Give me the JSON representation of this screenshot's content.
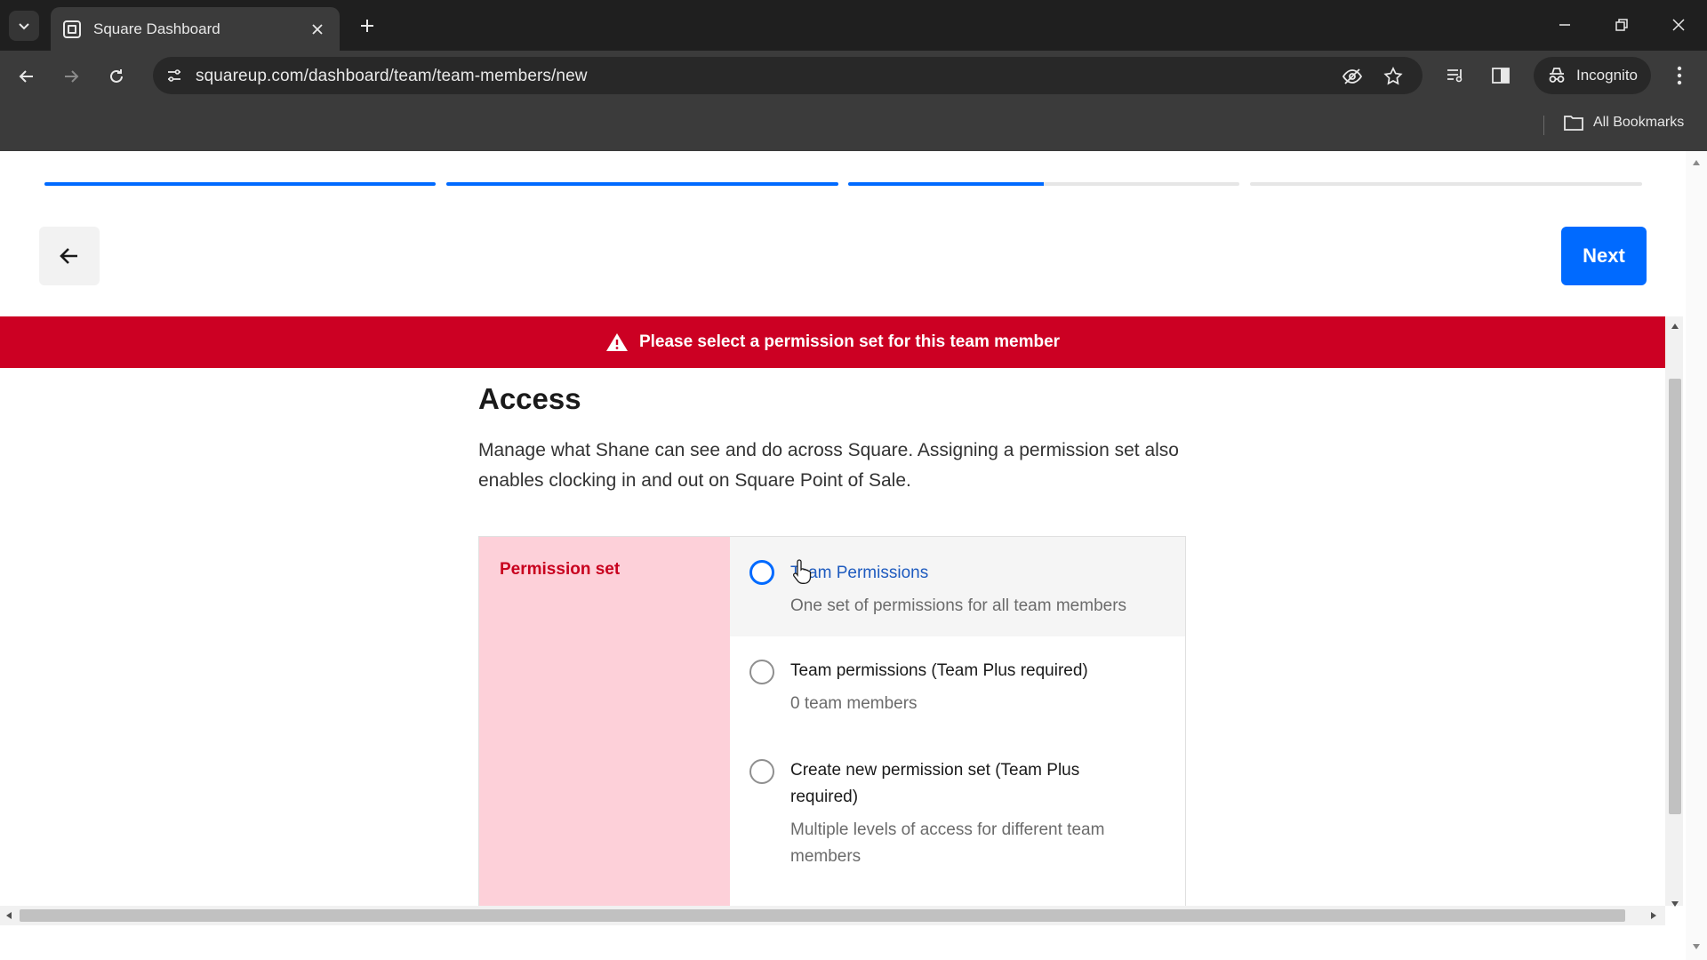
{
  "browser": {
    "tab_title": "Square Dashboard",
    "url": "squareup.com/dashboard/team/team-members/new",
    "incognito_label": "Incognito",
    "bookmarks_label": "All Bookmarks"
  },
  "wizard": {
    "steps_progress": [
      1.0,
      1.0,
      0.5,
      0.0
    ],
    "next_label": "Next"
  },
  "error": {
    "message": "Please select a permission set for this team member"
  },
  "access": {
    "title": "Access",
    "description": "Manage what Shane can see and do across Square. Assigning a permission set also enables clocking in and out on Square Point of Sale."
  },
  "permission_set": {
    "label": "Permission set",
    "options": [
      {
        "title": "Team Permissions",
        "subtitle": "One set of permissions for all team members"
      },
      {
        "title": "Team permissions (Team Plus required)",
        "subtitle": "0 team members"
      },
      {
        "title": "Create new permission set (Team Plus required)",
        "subtitle": "Multiple levels of access for different team members"
      }
    ]
  },
  "colors": {
    "accent": "#006aff",
    "error": "#cc0023",
    "error_tint": "#fdd0d9"
  }
}
